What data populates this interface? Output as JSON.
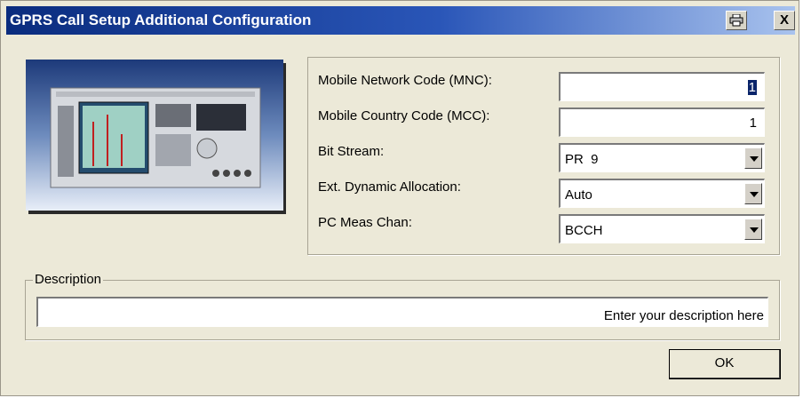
{
  "window": {
    "title": "GPRS Call Setup Additional Configuration",
    "print_icon": "printer-icon",
    "close_label": "X"
  },
  "params": {
    "mnc": {
      "label": "Mobile Network Code (MNC):",
      "value": "1"
    },
    "mcc": {
      "label": "Mobile Country Code (MCC):",
      "value": "1"
    },
    "bit_stream": {
      "label": "Bit Stream:",
      "value": "PR  9"
    },
    "ext_dyn_alloc": {
      "label": "Ext. Dynamic Allocation:",
      "value": "Auto"
    },
    "pc_meas_chan": {
      "label": "PC Meas Chan:",
      "value": "BCCH"
    }
  },
  "description": {
    "legend": "Description",
    "placeholder": "Enter your description here"
  },
  "buttons": {
    "ok": "OK"
  },
  "colors": {
    "title_start": "#0a2c7e",
    "title_end": "#a9c3ee",
    "dialog_bg": "#ece9d8"
  }
}
